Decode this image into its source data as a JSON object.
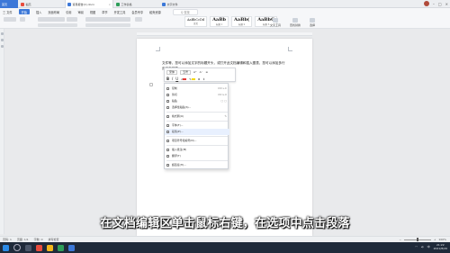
{
  "tabs": {
    "home": "首页",
    "t1": "稻壳",
    "document": "贸易报告(2).docx",
    "t3": "工作表格",
    "t4": "文字文件"
  },
  "menu": {
    "file": "三 文件",
    "items": [
      "开始",
      "插入",
      "页面布局",
      "引用",
      "审阅",
      "视图",
      "章节",
      "开发工具",
      "会员专享",
      "稻壳资源"
    ],
    "search": "Q 查找"
  },
  "ribbon": {
    "styles": [
      {
        "preview": "AaBbCcDd",
        "name": "正文"
      },
      {
        "preview": "AaBb",
        "name": "标题 1"
      },
      {
        "preview": "AaBb(",
        "name": "标题 2"
      },
      {
        "preview": "AaBbC",
        "name": "标题 3"
      }
    ],
    "tools": [
      "文字工具",
      "查找替换",
      "选择"
    ]
  },
  "document": {
    "text": "文件等，您可以添加文字的标题开头，或打开此文档编辑和插入图表，您可以添加多行页面文字等"
  },
  "mini_toolbar": {
    "font": "宋体",
    "size": "五号"
  },
  "context_menu": {
    "items": [
      {
        "label": "复制",
        "shortcut": "Ctrl+C"
      },
      {
        "label": "剪切",
        "shortcut": "Ctrl+X"
      },
      {
        "label": "粘贴",
        "shortcut": ""
      },
      {
        "label": "选择性粘贴(S)...",
        "shortcut": ""
      },
      {
        "label": "格式刷(O)",
        "shortcut": ""
      },
      {
        "label": "字体(F)...",
        "shortcut": ""
      },
      {
        "label": "段落(P)...",
        "shortcut": ""
      },
      {
        "label": "项目符号和编号(N)...",
        "shortcut": ""
      },
      {
        "label": "插入批注(M)",
        "shortcut": ""
      },
      {
        "label": "翻译(T)",
        "shortcut": ""
      },
      {
        "label": "超链接(H)...",
        "shortcut": ""
      }
    ]
  },
  "subtitle": "在文档编辑区单击鼠标右键，在选项中点击段落",
  "statusbar": {
    "page": "页码: 1",
    "pages": "页面: 1/1",
    "words": "字数: 0",
    "spell": "拼写检查",
    "zoom": "100%"
  },
  "taskbar": {
    "time": "21:22",
    "date": "2021/8/20"
  },
  "colors": {
    "accent": "#3c78d8",
    "taskbar": "#1f2a3a"
  }
}
